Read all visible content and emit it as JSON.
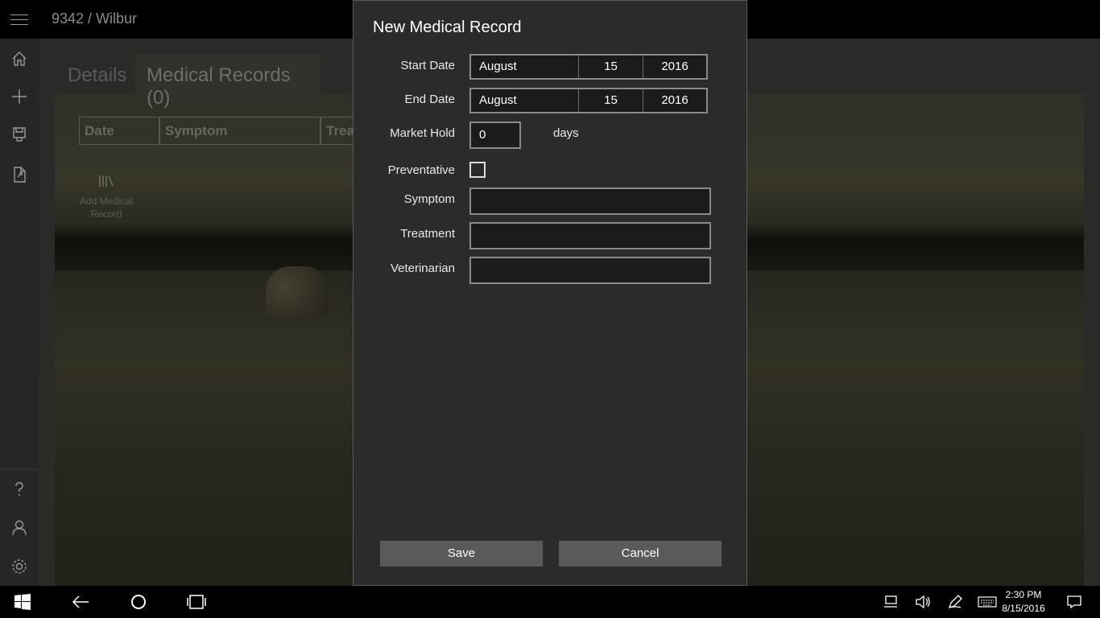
{
  "app": {
    "title": "9342 / Wilbur"
  },
  "nav": {
    "items": [
      "home-icon",
      "add-icon",
      "save-icon",
      "export-icon"
    ],
    "bottom": [
      "help-icon",
      "user-icon",
      "settings-icon"
    ]
  },
  "tabs": [
    {
      "label": "Details"
    },
    {
      "label": "Medical Records (0)"
    }
  ],
  "grid": {
    "headers": [
      "Date",
      "Symptom",
      "Trea"
    ]
  },
  "add_medical": {
    "label_line1": "Add Medical",
    "label_line2": "Record"
  },
  "dialog": {
    "title": "New Medical Record",
    "start_date": {
      "label": "Start Date",
      "month": "August",
      "day": "15",
      "year": "2016"
    },
    "end_date": {
      "label": "End Date",
      "month": "August",
      "day": "15",
      "year": "2016"
    },
    "market_hold": {
      "label": "Market Hold",
      "value": "0",
      "unit": "days"
    },
    "preventative": {
      "label": "Preventative",
      "checked": false
    },
    "symptom": {
      "label": "Symptom",
      "value": ""
    },
    "treatment": {
      "label": "Treatment",
      "value": ""
    },
    "veterinarian": {
      "label": "Veterinarian",
      "value": ""
    },
    "save_label": "Save",
    "cancel_label": "Cancel"
  },
  "taskbar": {
    "time": "2:30 PM",
    "date": "8/15/2016"
  }
}
